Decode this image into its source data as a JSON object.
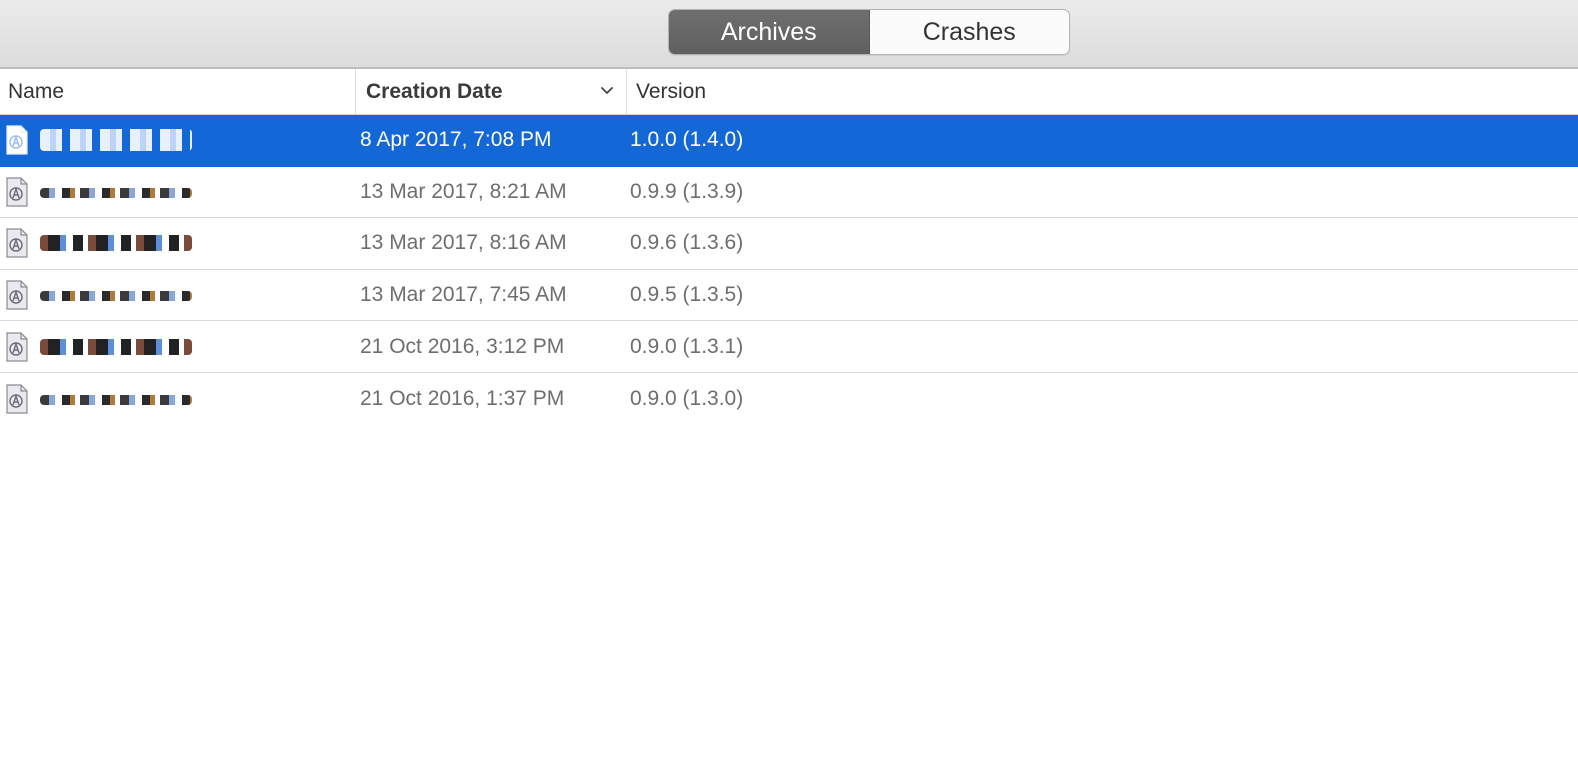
{
  "toolbar": {
    "tabs": [
      {
        "label": "Archives",
        "selected": true
      },
      {
        "label": "Crashes",
        "selected": false
      }
    ]
  },
  "table": {
    "columns": {
      "name": "Name",
      "creation_date": "Creation Date",
      "version": "Version"
    },
    "sort_icon": "chevron-down-icon",
    "rows": [
      {
        "name": "",
        "date": "8 Apr 2017, 7:08 PM",
        "version": "1.0.0 (1.4.0)",
        "selected": true
      },
      {
        "name": "",
        "date": "13 Mar 2017, 8:21 AM",
        "version": "0.9.9 (1.3.9)",
        "selected": false
      },
      {
        "name": "",
        "date": "13 Mar 2017, 8:16 AM",
        "version": "0.9.6 (1.3.6)",
        "selected": false
      },
      {
        "name": "",
        "date": "13 Mar 2017, 7:45 AM",
        "version": "0.9.5 (1.3.5)",
        "selected": false
      },
      {
        "name": "",
        "date": "21 Oct 2016, 3:12 PM",
        "version": "0.9.0 (1.3.1)",
        "selected": false
      },
      {
        "name": "",
        "date": "21 Oct 2016, 1:37 PM",
        "version": "0.9.0 (1.3.0)",
        "selected": false
      }
    ]
  },
  "colors": {
    "selection": "#1467d6",
    "toolbar": "#e3e3e3",
    "selected_segment": "#666666"
  }
}
